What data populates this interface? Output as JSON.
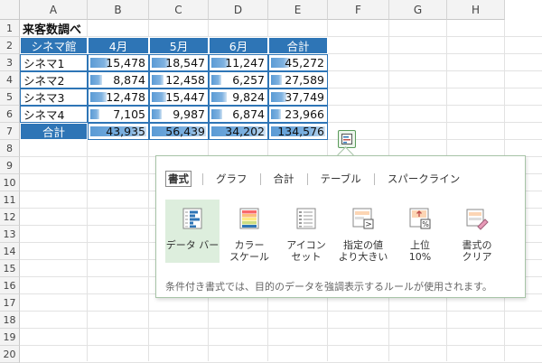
{
  "columns": [
    "A",
    "B",
    "C",
    "D",
    "E",
    "F",
    "G",
    "H"
  ],
  "rows": [
    "1",
    "2",
    "3",
    "4",
    "5",
    "6",
    "7",
    "8",
    "9",
    "10",
    "11",
    "12",
    "13",
    "14",
    "15",
    "16",
    "17",
    "18",
    "19",
    "20"
  ],
  "table": {
    "title": "来客数調べ",
    "headers": [
      "シネマ館",
      "4月",
      "5月",
      "6月",
      "合計"
    ],
    "data": [
      {
        "name": "シネマ1",
        "values": [
          "15,478",
          "18,547",
          "11,247",
          "45,272"
        ]
      },
      {
        "name": "シネマ2",
        "values": [
          "8,874",
          "12,458",
          "6,257",
          "27,589"
        ]
      },
      {
        "name": "シネマ3",
        "values": [
          "12,478",
          "15,447",
          "9,824",
          "37,749"
        ]
      },
      {
        "name": "シネマ4",
        "values": [
          "7,105",
          "9,987",
          "6,874",
          "23,966"
        ]
      }
    ],
    "total": {
      "label": "合計",
      "values": [
        "43,935",
        "56,439",
        "34,202",
        "134,576"
      ]
    }
  },
  "quick_analysis": {
    "button_icon": "quick-analysis-icon",
    "tabs": [
      "書式",
      "グラフ",
      "合計",
      "テーブル",
      "スパークライン"
    ],
    "selected_tab": "書式",
    "tools": [
      {
        "label": "データ バー",
        "icon": "data-bar-icon"
      },
      {
        "label": "カラー\nスケール",
        "icon": "color-scale-icon"
      },
      {
        "label": "アイコン\nセット",
        "icon": "icon-set-icon"
      },
      {
        "label": "指定の値\nより大きい",
        "icon": "greater-than-icon"
      },
      {
        "label": "上位\n10%",
        "icon": "top-ten-icon"
      },
      {
        "label": "書式の\nクリア",
        "icon": "clear-format-icon"
      }
    ],
    "selected_tool": "データ バー",
    "description": "条件付き書式では、目的のデータを強調表示するルールが使用されます。"
  }
}
